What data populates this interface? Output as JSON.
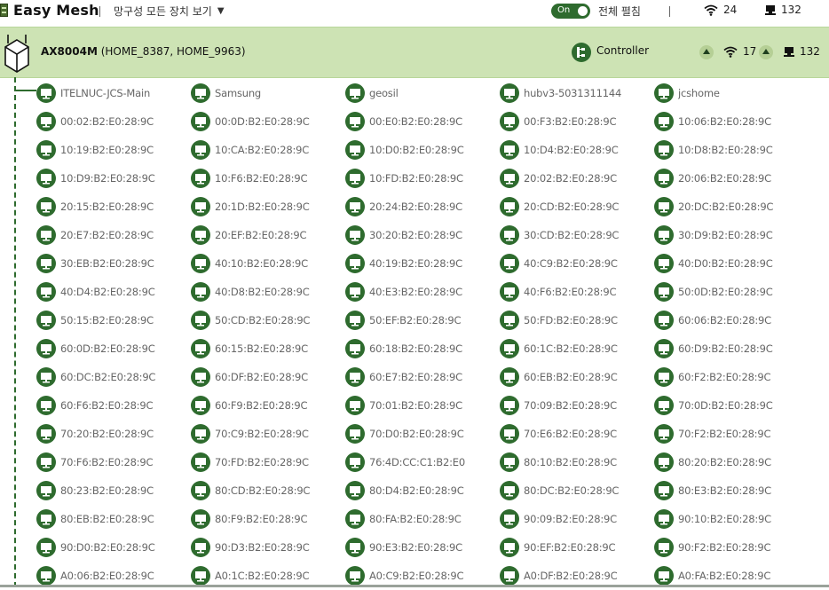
{
  "app": {
    "title": "Easy Mesh"
  },
  "topbar": {
    "view_select": "망구성 모든 장치 보기",
    "toggle_label": "On",
    "expand_label": "전체 펼침",
    "wifi_count": "24",
    "wired_count": "132"
  },
  "router": {
    "model": "AX8004M",
    "ssids": "(HOME_8387, HOME_9963)",
    "role": "Controller",
    "wifi_count": "17",
    "wired_count": "132"
  },
  "colors": {
    "accent": "#2e6b2e",
    "band": "#cde3b4"
  },
  "icons": {
    "device": "monitor-icon",
    "wifi": "wifi-icon",
    "wired": "wired-pc-icon",
    "controller": "controller-icon"
  },
  "devices": [
    "ITELNUC-JCS-Main",
    "Samsung",
    "geosil",
    "hubv3-5031311144",
    "jcshome",
    "00:02:B2:E0:28:9C",
    "00:0D:B2:E0:28:9C",
    "00:E0:B2:E0:28:9C",
    "00:F3:B2:E0:28:9C",
    "10:06:B2:E0:28:9C",
    "10:19:B2:E0:28:9C",
    "10:CA:B2:E0:28:9C",
    "10:D0:B2:E0:28:9C",
    "10:D4:B2:E0:28:9C",
    "10:D8:B2:E0:28:9C",
    "10:D9:B2:E0:28:9C",
    "10:F6:B2:E0:28:9C",
    "10:FD:B2:E0:28:9C",
    "20:02:B2:E0:28:9C",
    "20:06:B2:E0:28:9C",
    "20:15:B2:E0:28:9C",
    "20:1D:B2:E0:28:9C",
    "20:24:B2:E0:28:9C",
    "20:CD:B2:E0:28:9C",
    "20:DC:B2:E0:28:9C",
    "20:E7:B2:E0:28:9C",
    "20:EF:B2:E0:28:9C",
    "30:20:B2:E0:28:9C",
    "30:CD:B2:E0:28:9C",
    "30:D9:B2:E0:28:9C",
    "30:EB:B2:E0:28:9C",
    "40:10:B2:E0:28:9C",
    "40:19:B2:E0:28:9C",
    "40:C9:B2:E0:28:9C",
    "40:D0:B2:E0:28:9C",
    "40:D4:B2:E0:28:9C",
    "40:D8:B2:E0:28:9C",
    "40:E3:B2:E0:28:9C",
    "40:F6:B2:E0:28:9C",
    "50:0D:B2:E0:28:9C",
    "50:15:B2:E0:28:9C",
    "50:CD:B2:E0:28:9C",
    "50:EF:B2:E0:28:9C",
    "50:FD:B2:E0:28:9C",
    "60:06:B2:E0:28:9C",
    "60:0D:B2:E0:28:9C",
    "60:15:B2:E0:28:9C",
    "60:18:B2:E0:28:9C",
    "60:1C:B2:E0:28:9C",
    "60:D9:B2:E0:28:9C",
    "60:DC:B2:E0:28:9C",
    "60:DF:B2:E0:28:9C",
    "60:E7:B2:E0:28:9C",
    "60:EB:B2:E0:28:9C",
    "60:F2:B2:E0:28:9C",
    "60:F6:B2:E0:28:9C",
    "60:F9:B2:E0:28:9C",
    "70:01:B2:E0:28:9C",
    "70:09:B2:E0:28:9C",
    "70:0D:B2:E0:28:9C",
    "70:20:B2:E0:28:9C",
    "70:C9:B2:E0:28:9C",
    "70:D0:B2:E0:28:9C",
    "70:E6:B2:E0:28:9C",
    "70:F2:B2:E0:28:9C",
    "70:F6:B2:E0:28:9C",
    "70:FD:B2:E0:28:9C",
    "76:4D:CC:C1:B2:E0",
    "80:10:B2:E0:28:9C",
    "80:20:B2:E0:28:9C",
    "80:23:B2:E0:28:9C",
    "80:CD:B2:E0:28:9C",
    "80:D4:B2:E0:28:9C",
    "80:DC:B2:E0:28:9C",
    "80:E3:B2:E0:28:9C",
    "80:EB:B2:E0:28:9C",
    "80:F9:B2:E0:28:9C",
    "80:FA:B2:E0:28:9C",
    "90:09:B2:E0:28:9C",
    "90:10:B2:E0:28:9C",
    "90:D0:B2:E0:28:9C",
    "90:D3:B2:E0:28:9C",
    "90:E3:B2:E0:28:9C",
    "90:EF:B2:E0:28:9C",
    "90:F2:B2:E0:28:9C",
    "A0:06:B2:E0:28:9C",
    "A0:1C:B2:E0:28:9C",
    "A0:C9:B2:E0:28:9C",
    "A0:DF:B2:E0:28:9C",
    "A0:FA:B2:E0:28:9C"
  ]
}
